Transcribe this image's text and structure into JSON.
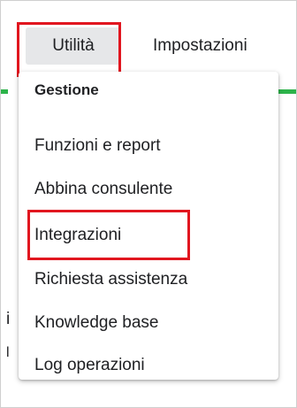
{
  "menubar": {
    "tabs": [
      {
        "label": "Utilità"
      },
      {
        "label": "Impostazioni"
      }
    ]
  },
  "dropdown": {
    "heading": "Gestione",
    "items": [
      {
        "label": "Funzioni e report"
      },
      {
        "label": "Abbina consulente"
      },
      {
        "label": "Integrazioni"
      },
      {
        "label": "Richiesta assistenza"
      },
      {
        "label": "Knowledge base"
      },
      {
        "label": "Log operazioni"
      }
    ]
  },
  "colors": {
    "highlight": "#e1161f",
    "accent_strip": "#2db34a",
    "active_tab_bg": "#e6e7e9"
  }
}
